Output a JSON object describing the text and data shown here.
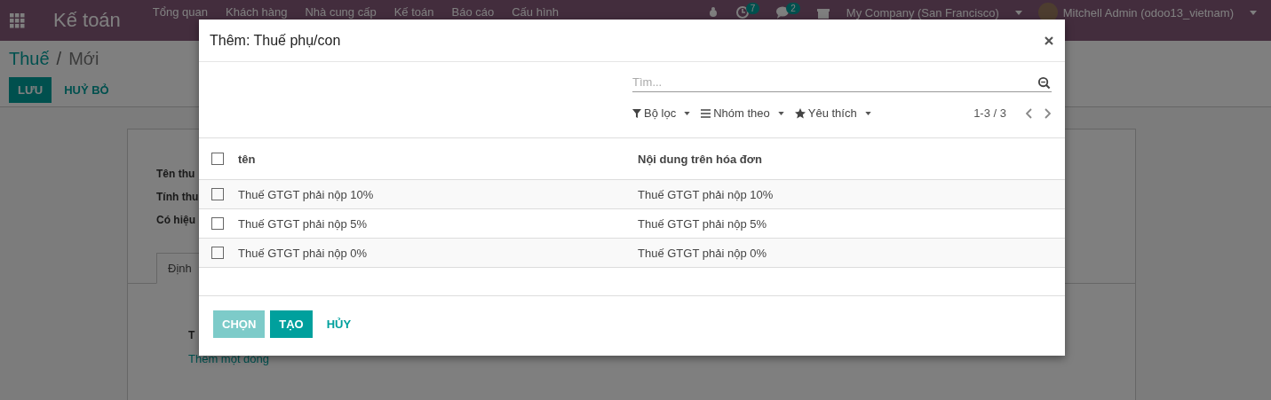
{
  "navbar": {
    "app_name": "Kế toán",
    "menu": [
      "Tổng quan",
      "Khách hàng",
      "Nhà cung cấp",
      "Kế toán",
      "Báo cáo",
      "Cấu hình"
    ],
    "activity_count": "7",
    "message_count": "2",
    "company": "My Company (San Francisco)",
    "user": "Mitchell Admin (odoo13_vietnam)"
  },
  "breadcrumb": {
    "parent": "Thuế",
    "separator": "/",
    "current": "Mới"
  },
  "form_buttons": [
    {
      "label": "LƯU",
      "kind": "primary"
    },
    {
      "label": "HUỶ BỎ",
      "kind": "link"
    }
  ],
  "form": {
    "labels": [
      "Tên thu",
      "Tính thu",
      "Có hiệu"
    ],
    "tab": "Định",
    "field_label": "T",
    "add_line": "Thêm một dòng"
  },
  "dialog": {
    "title": "Thêm: Thuế phụ/con",
    "search": {
      "placeholder": "Tìm..."
    },
    "filters": [
      {
        "label": "Bộ lọc",
        "kind": "filter"
      },
      {
        "label": "Nhóm theo",
        "kind": "group"
      },
      {
        "label": "Yêu thích",
        "kind": "favorite"
      }
    ],
    "pager": "1-3 / 3",
    "header_checked": false,
    "columns": [
      "tên",
      "Nội dung trên hóa đơn"
    ],
    "rows": [
      {
        "name": "Thuế GTGT phải nộp 10%",
        "invoice_label": "Thuế GTGT phải nộp 10%",
        "checked": false
      },
      {
        "name": "Thuế GTGT phải nộp 5%",
        "invoice_label": "Thuế GTGT phải nộp 5%",
        "checked": false
      },
      {
        "name": "Thuế GTGT phải nộp 0%",
        "invoice_label": "Thuế GTGT phải nộp 0%",
        "checked": false
      }
    ],
    "buttons": [
      {
        "label": "CHỌN",
        "kind": "primary",
        "disabled": true
      },
      {
        "label": "TẠO",
        "kind": "primary",
        "disabled": false
      },
      {
        "label": "HỦY",
        "kind": "link",
        "disabled": false
      }
    ]
  }
}
